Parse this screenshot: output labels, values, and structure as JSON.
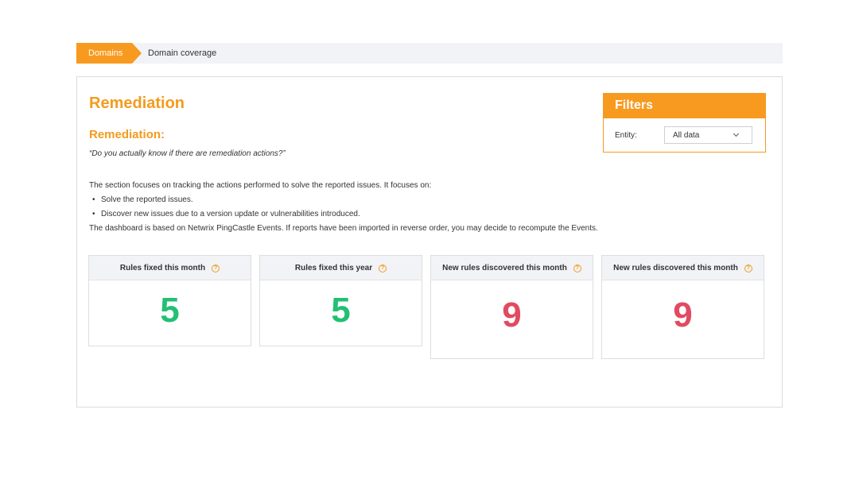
{
  "breadcrumb": {
    "items": [
      "Domains",
      "Domain coverage"
    ]
  },
  "page": {
    "title": "Remediation",
    "section_title": "Remediation:",
    "quote": "“Do you actually know if there are remediation actions?”",
    "description": "The section focuses on tracking the actions performed to solve the reported issues. It focuses on:",
    "bullets": [
      "Solve the reported issues.",
      "Discover new issues due to a version update or vulnerabilities introduced."
    ],
    "note": "The dashboard is based on Netwrix PingCastle Events. If reports have been imported in reverse order, you may decide to recompute the Events."
  },
  "filters": {
    "title": "Filters",
    "entity_label": "Entity:",
    "entity_value": "All data"
  },
  "cards": [
    {
      "label": "Rules fixed this month",
      "value": "5",
      "color": "#22c073"
    },
    {
      "label": "Rules fixed this year",
      "value": "5",
      "color": "#22c073"
    },
    {
      "label": "New rules discovered this month",
      "value": "9",
      "color": "#e14b62"
    },
    {
      "label": "New rules discovered this month",
      "value": "9",
      "color": "#e14b62"
    }
  ],
  "icons": {
    "help": "help-circle-icon",
    "dropdown": "chevron-down-icon"
  },
  "colors": {
    "accent": "#f79a1f",
    "positive": "#22c073",
    "negative": "#e14b62"
  }
}
